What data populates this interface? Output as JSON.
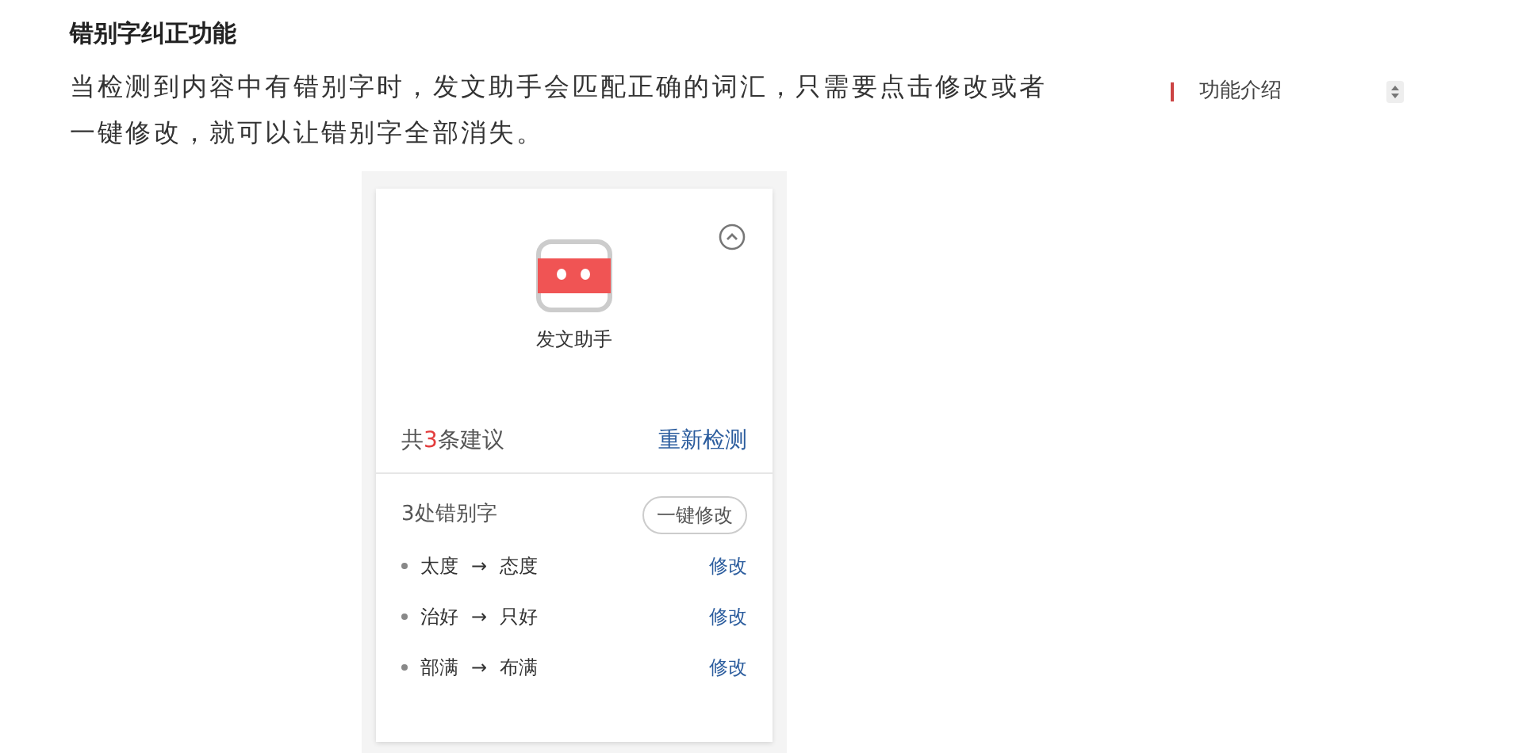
{
  "heading": "错别字纠正功能",
  "paragraph": "当检测到内容中有错别字时，发文助手会匹配正确的词汇，只需要点击修改或者一键修改，就可以让错别字全部消失。",
  "side_nav": {
    "label": "功能介绍"
  },
  "panel": {
    "app_name": "发文助手",
    "summary_prefix": "共",
    "summary_count": "3",
    "summary_suffix": "条建议",
    "recheck": "重新检测",
    "section_title": "3处错别字",
    "fix_all": "一键修改",
    "suggestions": [
      {
        "wrong": "太度",
        "arrow": "→",
        "right": "态度",
        "action": "修改"
      },
      {
        "wrong": "治好",
        "arrow": "→",
        "right": "只好",
        "action": "修改"
      },
      {
        "wrong": "部满",
        "arrow": "→",
        "right": "布满",
        "action": "修改"
      }
    ]
  }
}
